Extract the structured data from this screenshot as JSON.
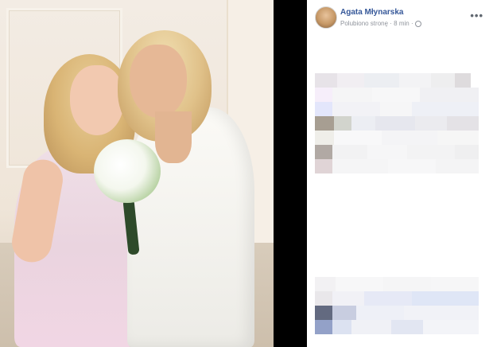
{
  "post": {
    "author": "Agata Młynarska",
    "meta": "Polubiono stronę · 8 min ·",
    "more_label": "•••",
    "avatar_icon": "profile-avatar",
    "audience_icon": "globe-icon",
    "photo": "photo-two-women-with-bouquet"
  },
  "colors": {
    "author_link": "#365899",
    "meta_text": "#90949c",
    "panel_bg": "#ffffff",
    "frame_bg": "#000000"
  }
}
